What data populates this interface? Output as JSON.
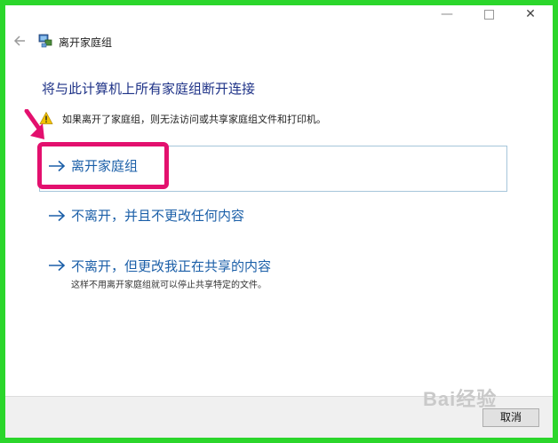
{
  "window": {
    "minimize_glyph": "—",
    "close_glyph": "✕",
    "title": "离开家庭组"
  },
  "heading": "将与此计算机上所有家庭组断开连接",
  "warning": {
    "text": "如果离开了家庭组，则无法访问或共享家庭组文件和打印机。"
  },
  "options": [
    {
      "label": "离开家庭组"
    },
    {
      "label": "不离开，并且不更改任何内容"
    },
    {
      "label": "不离开，但更改我正在共享的内容",
      "description": "这样不用离开家庭组就可以停止共享特定的文件。"
    }
  ],
  "footer": {
    "cancel_label": "取消"
  },
  "watermark": "Bai经验",
  "colors": {
    "frame_border": "#2bd62b",
    "highlight_border": "#e3106e",
    "link_blue": "#1b5fa8",
    "heading_blue": "#1e3287"
  },
  "icons": {
    "back": "back-arrow-icon",
    "app": "homegroup-icon",
    "warning": "warning-icon",
    "option_arrow": "right-arrow-icon"
  }
}
